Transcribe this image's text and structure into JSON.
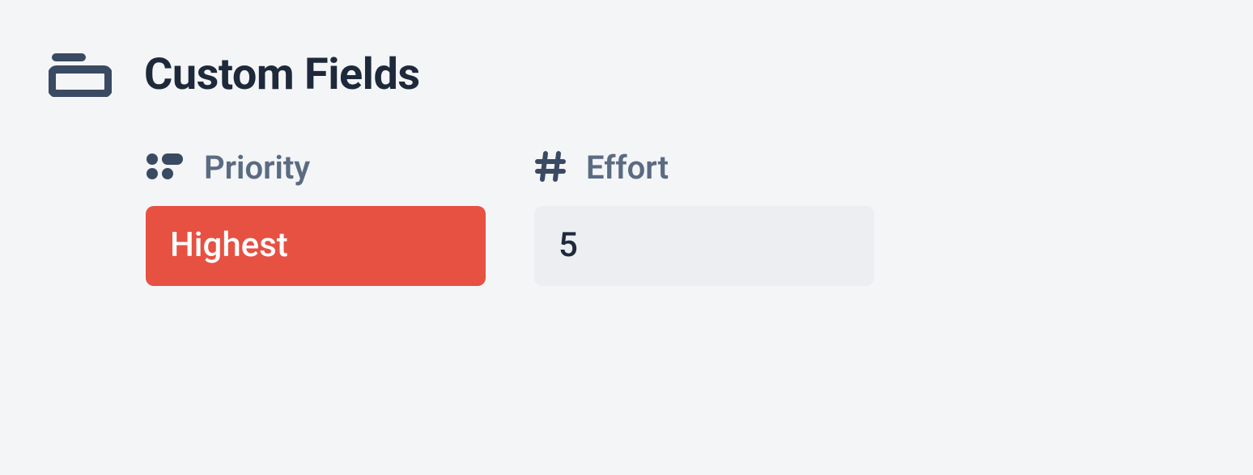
{
  "section": {
    "title": "Custom Fields",
    "fields": [
      {
        "icon": "options-icon",
        "label": "Priority",
        "value": "Highest",
        "style": "badge-red"
      },
      {
        "icon": "hash-icon",
        "label": "Effort",
        "value": "5",
        "style": "neutral"
      }
    ]
  },
  "colors": {
    "badge_red_bg": "#e65142",
    "badge_red_fg": "#ffffff",
    "neutral_bg": "#eceef1",
    "neutral_fg": "#1e2a3b"
  }
}
